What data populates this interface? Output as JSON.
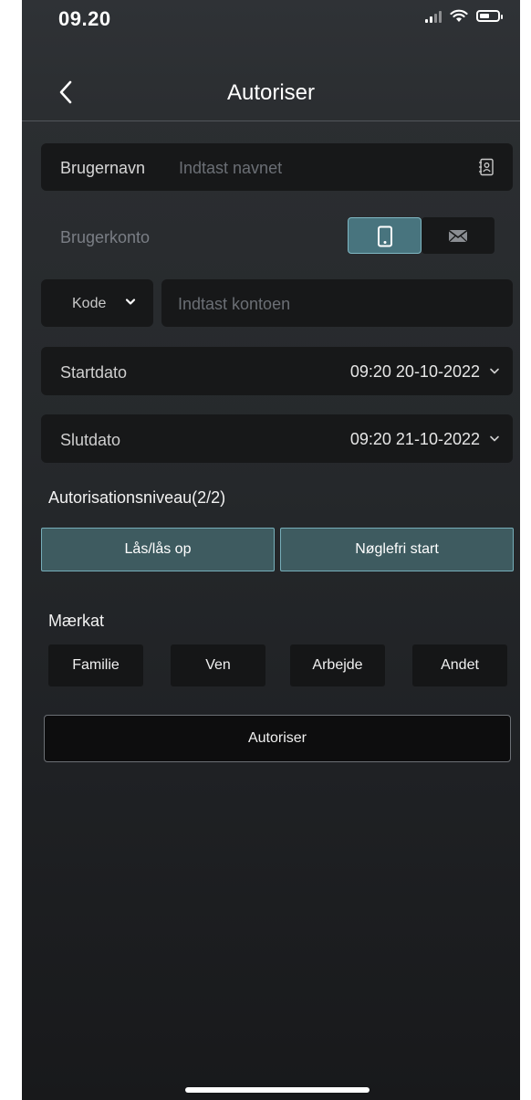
{
  "status_bar": {
    "time": "09.20"
  },
  "nav": {
    "title": "Autoriser"
  },
  "username": {
    "label": "Brugernavn",
    "placeholder": "Indtast navnet"
  },
  "account": {
    "label": "Brugerkonto",
    "selected_type": "phone",
    "code_label": "Kode",
    "placeholder": "Indtast kontoen"
  },
  "start": {
    "label": "Startdato",
    "value": "09:20 20-10-2022"
  },
  "end": {
    "label": "Slutdato",
    "value": "09:20 21-10-2022"
  },
  "auth_level": {
    "title": "Autorisationsniveau(2/2)",
    "options": [
      "Lås/lås op",
      "Nøglefri start"
    ]
  },
  "tags": {
    "title": "Mærkat",
    "items": [
      "Familie",
      "Ven",
      "Arbejde",
      "Andet"
    ]
  },
  "submit_label": "Autoriser",
  "colors": {
    "accent": "#48747e",
    "accent_border": "#7fb7c3",
    "level_bg": "#3e5b60"
  }
}
